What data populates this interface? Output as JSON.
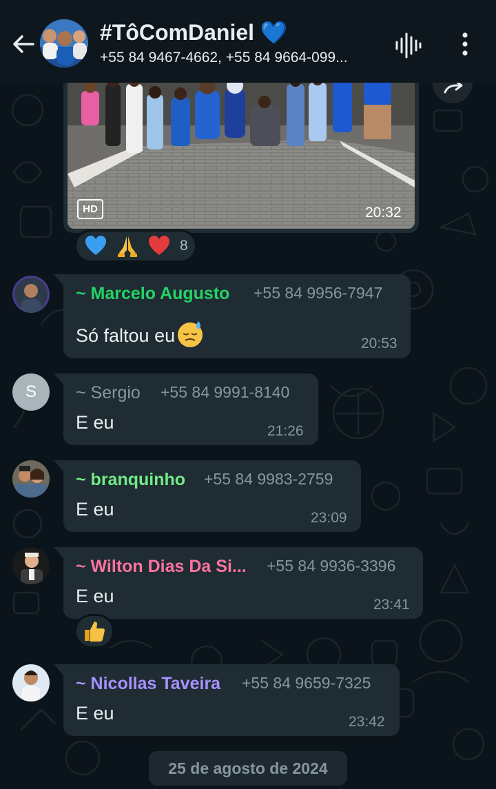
{
  "header": {
    "title": "#TôComDaniel 💙",
    "subtitle": "+55 84 9467-4662, +55 84 9664-099..."
  },
  "image_message": {
    "hd_label": "HD",
    "time": "20:32",
    "reaction_count": "8"
  },
  "messages": [
    {
      "sender": "~ Marcelo Augusto",
      "phone": "+55 84 9956-7947",
      "text": "Só faltou eu",
      "time": "20:53",
      "sender_color": "#25d366"
    },
    {
      "sender": "~ Sergio",
      "phone": "+55 84 9991-8140",
      "text": "E eu",
      "time": "21:26",
      "sender_color": "#8696a0",
      "avatar_letter": "S"
    },
    {
      "sender": "~ branquinho",
      "phone": "+55 84 9983-2759",
      "text": "E eu",
      "time": "23:09",
      "sender_color": "#71eb85"
    },
    {
      "sender": "~ Wilton Dias Da Si...",
      "phone": "+55 84 9936-3396",
      "text": "E eu",
      "time": "23:41",
      "sender_color": "#ff72a1"
    },
    {
      "sender": "~ Nicollas Taveira",
      "phone": "+55 84 9659-7325",
      "text": "E eu",
      "time": "23:42",
      "sender_color": "#a791ff"
    }
  ],
  "date_separator": "25 de agosto de 2024",
  "icons": [
    "back-arrow-icon",
    "voice-chat-icon",
    "more-options-icon",
    "forward-icon",
    "blue-heart-icon",
    "praying-hands-icon",
    "red-heart-icon",
    "downcast-sweat-emoji",
    "thumbs-up-icon"
  ]
}
